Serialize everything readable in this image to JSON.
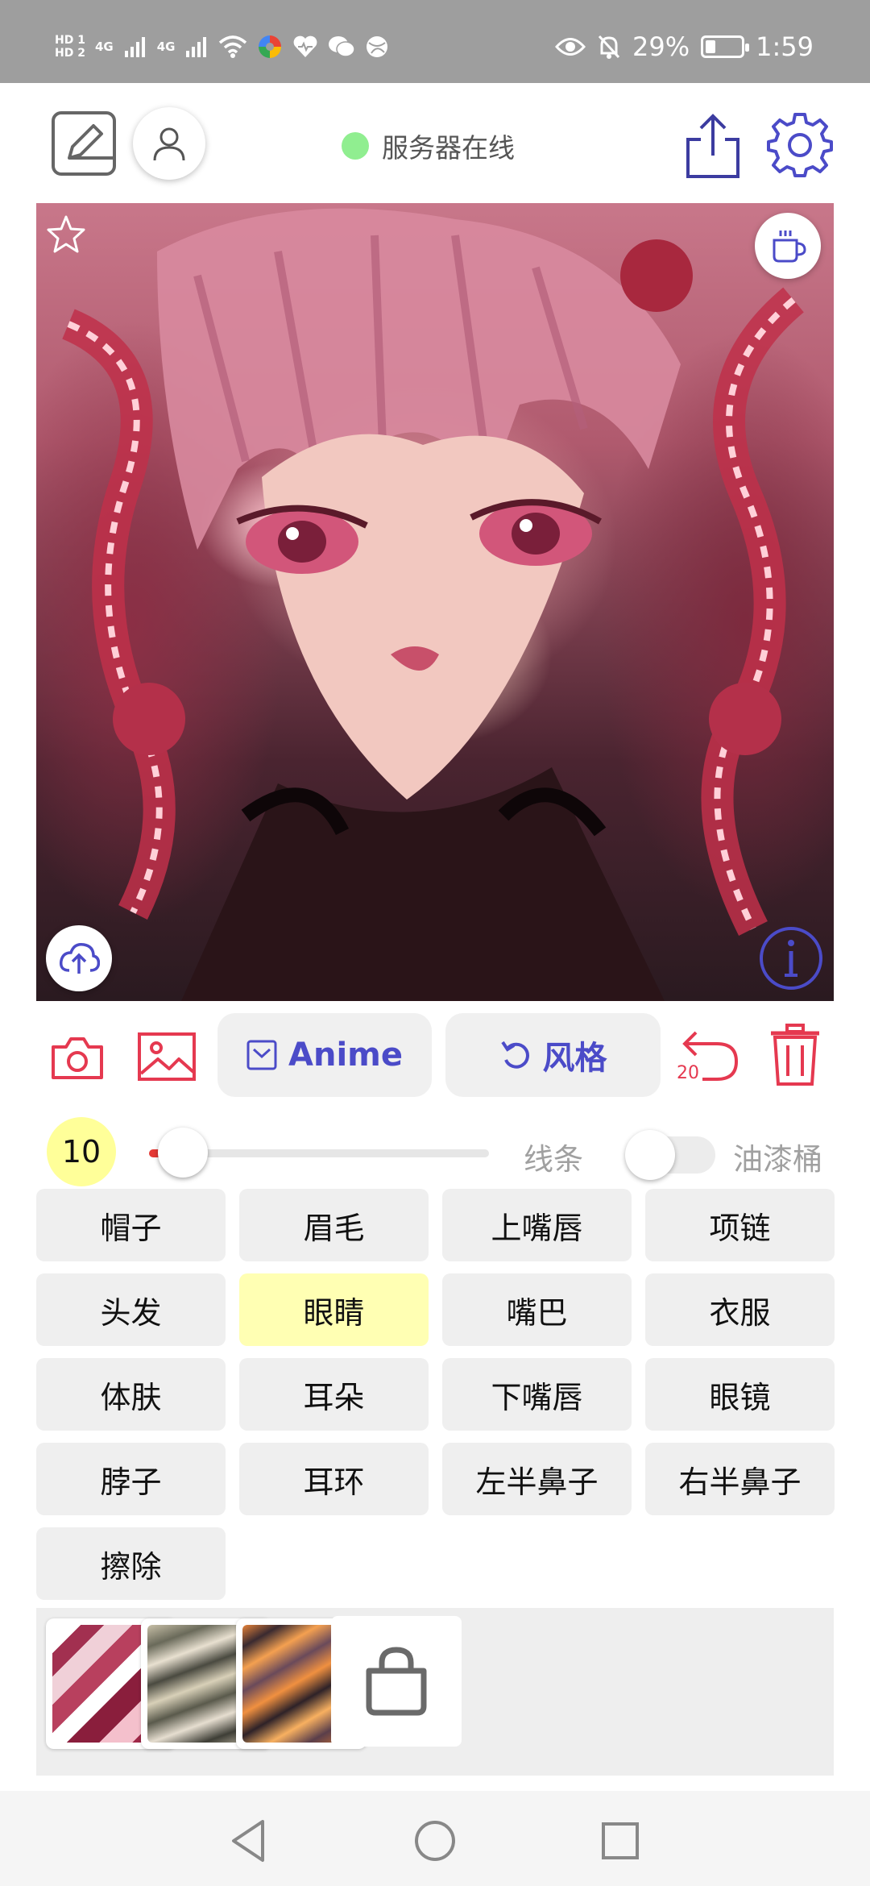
{
  "status_bar": {
    "hd_tags": [
      "HD 1",
      "HD 2"
    ],
    "network_labels": [
      "4G",
      "4G"
    ],
    "battery_percent": "29%",
    "battery_level": 0.29,
    "time": "1:59"
  },
  "top_bar": {
    "server_status": "服务器在线",
    "server_status_color": "#90ee90",
    "icons": [
      "edit-icon",
      "profile-icon",
      "share-icon",
      "settings-icon"
    ]
  },
  "canvas": {
    "icons": [
      "star-icon",
      "coffee-icon",
      "upload-icon",
      "info-icon"
    ]
  },
  "toolbar": {
    "anime_label": "Anime",
    "style_label": "风格",
    "undo_count": "20",
    "icons": [
      "camera-icon",
      "gallery-icon",
      "checkbox-icon",
      "refresh-icon",
      "undo-icon",
      "trash-icon"
    ]
  },
  "brush": {
    "size": "10",
    "slider_fraction": 0.1,
    "line_label": "线条",
    "bucket_label": "油漆桶",
    "bucket_enabled": false
  },
  "labels": [
    {
      "text": "帽子",
      "selected": false
    },
    {
      "text": "眉毛",
      "selected": false
    },
    {
      "text": "上嘴唇",
      "selected": false
    },
    {
      "text": "项链",
      "selected": false
    },
    {
      "text": "头发",
      "selected": false
    },
    {
      "text": "眼睛",
      "selected": true
    },
    {
      "text": "嘴巴",
      "selected": false
    },
    {
      "text": "衣服",
      "selected": false
    },
    {
      "text": "体肤",
      "selected": false
    },
    {
      "text": "耳朵",
      "selected": false
    },
    {
      "text": "下嘴唇",
      "selected": false
    },
    {
      "text": "眼镜",
      "selected": false
    },
    {
      "text": "脖子",
      "selected": false
    },
    {
      "text": "耳环",
      "selected": false
    },
    {
      "text": "左半鼻子",
      "selected": false
    },
    {
      "text": "右半鼻子",
      "selected": false
    },
    {
      "text": "擦除",
      "selected": false
    }
  ],
  "palette": {
    "swatches": [
      "style-red-swatch",
      "style-gray-swatch",
      "style-orange-swatch"
    ],
    "shop_icon": "shopping-bag-icon"
  },
  "colors": {
    "accent_red": "#e53935",
    "accent_blue": "#4b4bc8",
    "selected_label": "#ffffb3"
  }
}
